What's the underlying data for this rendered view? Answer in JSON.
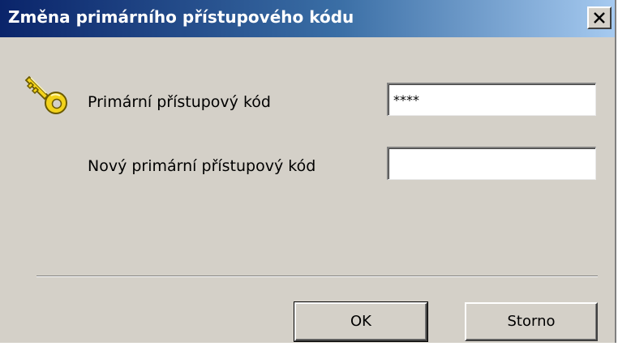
{
  "dialog": {
    "title": "Změna primárního přístupového kódu",
    "close_icon": "close-icon",
    "key_icon": "key-icon"
  },
  "fields": {
    "current_code_label": "Primární přístupový kód",
    "current_code_value": "****",
    "new_code_label": "Nový primární přístupový kód",
    "new_code_value": ""
  },
  "buttons": {
    "ok_label": "OK",
    "cancel_label": "Storno"
  },
  "colors": {
    "titlebar_start": "#0a246a",
    "titlebar_end": "#a6caf0",
    "dialog_bg": "#d4d0c8",
    "key_gold": "#f2d21b"
  }
}
